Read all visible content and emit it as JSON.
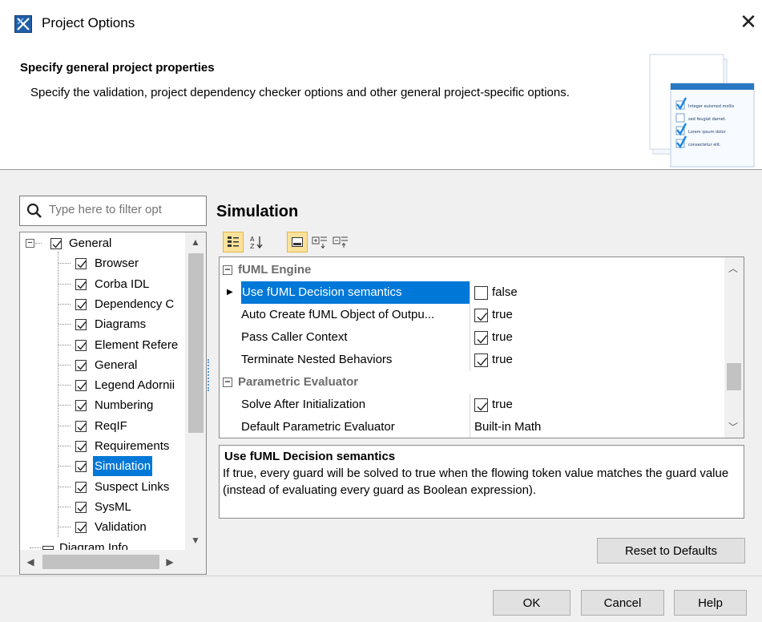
{
  "window": {
    "title": "Project Options",
    "close_icon": "close-icon",
    "app_icon": "magicdraw-app-icon"
  },
  "header": {
    "title": "Specify general project properties",
    "description": "Specify the validation, project dependency checker options and other general project-specific options.",
    "image_lines": [
      "Integer euismod mollis",
      "sed feugiat damet.",
      "Lorem ipsum dolor",
      "consectetur elit."
    ],
    "image_checks": [
      true,
      false,
      true,
      true
    ]
  },
  "filter": {
    "placeholder": "Type here to filter opt",
    "icon": "search-icon"
  },
  "tree": {
    "items": [
      {
        "label": "General",
        "level": 0,
        "checked": true,
        "expander": "minus"
      },
      {
        "label": "Browser",
        "level": 1,
        "checked": true
      },
      {
        "label": "Corba IDL",
        "level": 1,
        "checked": true
      },
      {
        "label": "Dependency C",
        "level": 1,
        "checked": true
      },
      {
        "label": "Diagrams",
        "level": 1,
        "checked": true
      },
      {
        "label": "Element Refere",
        "level": 1,
        "checked": true
      },
      {
        "label": "General",
        "level": 1,
        "checked": true
      },
      {
        "label": "Legend Adornii",
        "level": 1,
        "checked": true
      },
      {
        "label": "Numbering",
        "level": 1,
        "checked": true
      },
      {
        "label": "ReqIF",
        "level": 1,
        "checked": true
      },
      {
        "label": "Requirements",
        "level": 1,
        "checked": true
      },
      {
        "label": "Simulation",
        "level": 1,
        "checked": true,
        "selected": true
      },
      {
        "label": "Suspect Links",
        "level": 1,
        "checked": true
      },
      {
        "label": "SysML",
        "level": 1,
        "checked": true
      },
      {
        "label": "Validation",
        "level": 1,
        "checked": true
      },
      {
        "label": "Diagram Info",
        "level": 0,
        "icon": "table-icon"
      }
    ]
  },
  "section": {
    "title": "Simulation"
  },
  "toolbar": {
    "buttons": [
      {
        "name": "categorized-view-button",
        "icon": "categorized-icon",
        "active": true
      },
      {
        "name": "sort-alphabetical-button",
        "icon": "sort-az-icon",
        "active": false
      },
      {
        "name": "show-description-button",
        "icon": "description-icon",
        "active": true
      },
      {
        "name": "expand-all-button",
        "icon": "expand-all-icon",
        "active": false
      },
      {
        "name": "collapse-all-button",
        "icon": "collapse-all-icon",
        "active": false
      }
    ]
  },
  "properties": {
    "rows": [
      {
        "type": "category",
        "label": "fUML Engine"
      },
      {
        "type": "prop",
        "name": "Use fUML Decision semantics",
        "value": "false",
        "checkbox": false,
        "selected": true
      },
      {
        "type": "prop",
        "name": "Auto Create fUML Object of Outpu...",
        "value": "true",
        "checkbox": true
      },
      {
        "type": "prop",
        "name": "Pass Caller Context",
        "value": "true",
        "checkbox": true
      },
      {
        "type": "prop",
        "name": "Terminate Nested Behaviors",
        "value": "true",
        "checkbox": true
      },
      {
        "type": "category",
        "label": "Parametric Evaluator"
      },
      {
        "type": "prop",
        "name": "Solve After Initialization",
        "value": "true",
        "checkbox": true
      },
      {
        "type": "prop",
        "name": "Default Parametric Evaluator",
        "value": "Built-in Math",
        "checkbox": null
      }
    ]
  },
  "description": {
    "title": "Use fUML Decision semantics",
    "text": "If true, every guard will be solved to true when the flowing token value matches the guard value (instead of evaluating every guard as Boolean expression)."
  },
  "buttons": {
    "reset": "Reset to Defaults",
    "ok": "OK",
    "cancel": "Cancel",
    "help": "Help"
  },
  "colors": {
    "selection": "#0078d7",
    "toolbar_active": "#fbe29b",
    "category_text": "#6b6b6b"
  }
}
